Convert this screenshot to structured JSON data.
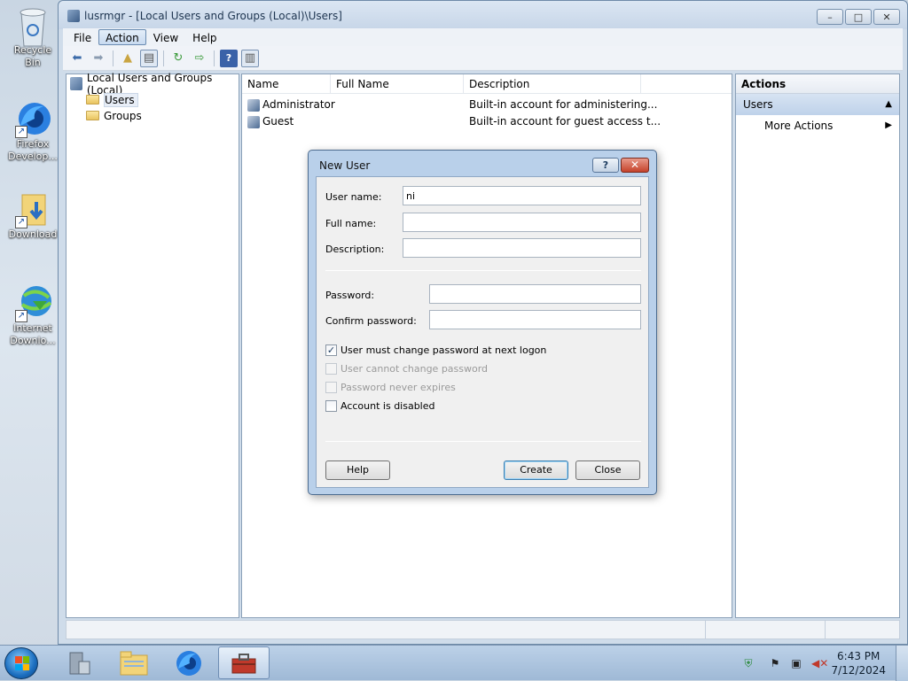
{
  "desktop": {
    "icons": [
      {
        "label": "Recycle Bin",
        "icon": "recycle-bin-icon"
      },
      {
        "label": "Firefox\nDevelop...",
        "icon": "firefox-developer-icon"
      },
      {
        "label": "Download",
        "icon": "downloads-folder-icon"
      },
      {
        "label": "Internet\nDownlo...",
        "icon": "internet-download-manager-icon"
      }
    ]
  },
  "window": {
    "title": "lusrmgr - [Local Users and Groups (Local)\\Users]",
    "controls": {
      "minimize": "–",
      "maximize": "□",
      "close": "✕"
    }
  },
  "menu": {
    "items": [
      "File",
      "Action",
      "View",
      "Help"
    ],
    "active": "Action"
  },
  "toolbar": {
    "icons": [
      "back-arrow-icon",
      "forward-arrow-icon",
      "up-folder-icon",
      "show-hide-tree-icon",
      "refresh-icon",
      "export-list-icon",
      "help-icon",
      "show-hide-action-pane-icon"
    ]
  },
  "tree": {
    "root": "Local Users and Groups (Local)",
    "children": [
      "Users",
      "Groups"
    ],
    "selected": "Users"
  },
  "list": {
    "columns": [
      "Name",
      "Full Name",
      "Description"
    ],
    "rows": [
      {
        "name": "Administrator",
        "full_name": "",
        "description": "Built-in account for administering..."
      },
      {
        "name": "Guest",
        "full_name": "",
        "description": "Built-in account for guest access t..."
      }
    ]
  },
  "actions": {
    "title": "Actions",
    "group": "Users",
    "items": [
      "More Actions"
    ]
  },
  "dialog": {
    "title": "New User",
    "help_glyph": "?",
    "close_glyph": "✕",
    "user_name_label": "User name:",
    "user_name_value": "ni",
    "full_name_label": "Full name:",
    "full_name_value": "",
    "description_label": "Description:",
    "description_value": "",
    "password_label": "Password:",
    "confirm_password_label": "Confirm password:",
    "checkboxes": [
      {
        "label": "User must change password at next logon",
        "checked": true,
        "enabled": true
      },
      {
        "label": "User cannot change password",
        "checked": false,
        "enabled": false
      },
      {
        "label": "Password never expires",
        "checked": false,
        "enabled": false
      },
      {
        "label": "Account is disabled",
        "checked": false,
        "enabled": true
      }
    ],
    "buttons": {
      "help": "Help",
      "create": "Create",
      "close": "Close"
    }
  },
  "taskbar": {
    "apps": [
      "server-manager-icon",
      "windows-explorer-icon",
      "firefox-icon",
      "computer-management-icon"
    ],
    "active_app": "computer-management-icon",
    "tray": [
      "security-shield-icon",
      "action-center-flag-icon",
      "network-icon",
      "volume-muted-icon"
    ],
    "time": "6:43 PM",
    "date": "7/12/2024"
  }
}
